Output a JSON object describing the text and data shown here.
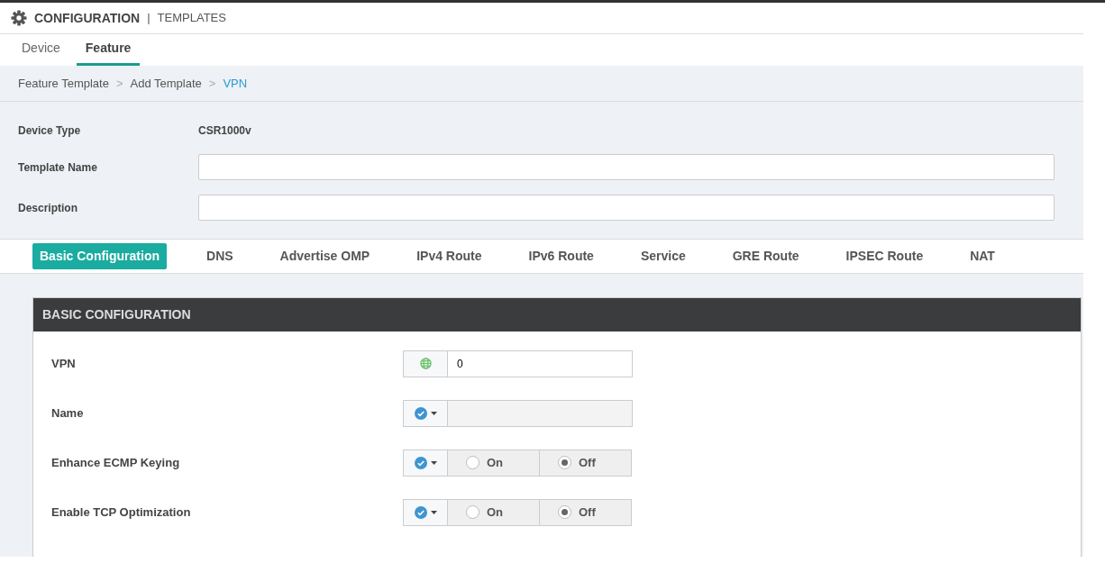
{
  "header": {
    "title": "CONFIGURATION",
    "separator": "|",
    "subtitle": "TEMPLATES"
  },
  "breadcrumb_separator": ">",
  "tabs": [
    {
      "label": "Device",
      "selected": false
    },
    {
      "label": "Feature",
      "selected": true
    }
  ],
  "breadcrumb": [
    {
      "label": "Feature Template",
      "current": false
    },
    {
      "label": "Add Template",
      "current": false
    },
    {
      "label": "VPN",
      "current": true
    }
  ],
  "form": {
    "device_type": {
      "label": "Device Type",
      "value": "CSR1000v"
    },
    "fields": [
      {
        "label": "Template Name"
      },
      {
        "label": "Description"
      }
    ]
  },
  "section_tabs": [
    {
      "label": "Basic Configuration",
      "selected": true
    },
    {
      "label": "DNS",
      "selected": false
    },
    {
      "label": "Advertise OMP",
      "selected": false
    },
    {
      "label": "IPv4 Route",
      "selected": false
    },
    {
      "label": "IPv6 Route",
      "selected": false
    },
    {
      "label": "Service",
      "selected": false
    },
    {
      "label": "GRE Route",
      "selected": false
    },
    {
      "label": "IPSEC Route",
      "selected": false
    },
    {
      "label": "NAT",
      "selected": false
    }
  ],
  "panel": {
    "title": "BASIC CONFIGURATION",
    "rows": [
      {
        "label": "VPN",
        "kind": "text",
        "global": true,
        "value": "0",
        "disabled": false
      },
      {
        "label": "Name",
        "kind": "text",
        "global": false,
        "disabled": true
      },
      {
        "label": "Enhance ECMP Keying",
        "kind": "radio",
        "global": false,
        "options": [
          {
            "label": "On",
            "selected": false
          },
          {
            "label": "Off",
            "selected": true
          }
        ]
      },
      {
        "label": "Enable TCP Optimization",
        "kind": "radio",
        "global": false,
        "options": [
          {
            "label": "On",
            "selected": false
          },
          {
            "label": "Off",
            "selected": true
          }
        ]
      }
    ]
  }
}
